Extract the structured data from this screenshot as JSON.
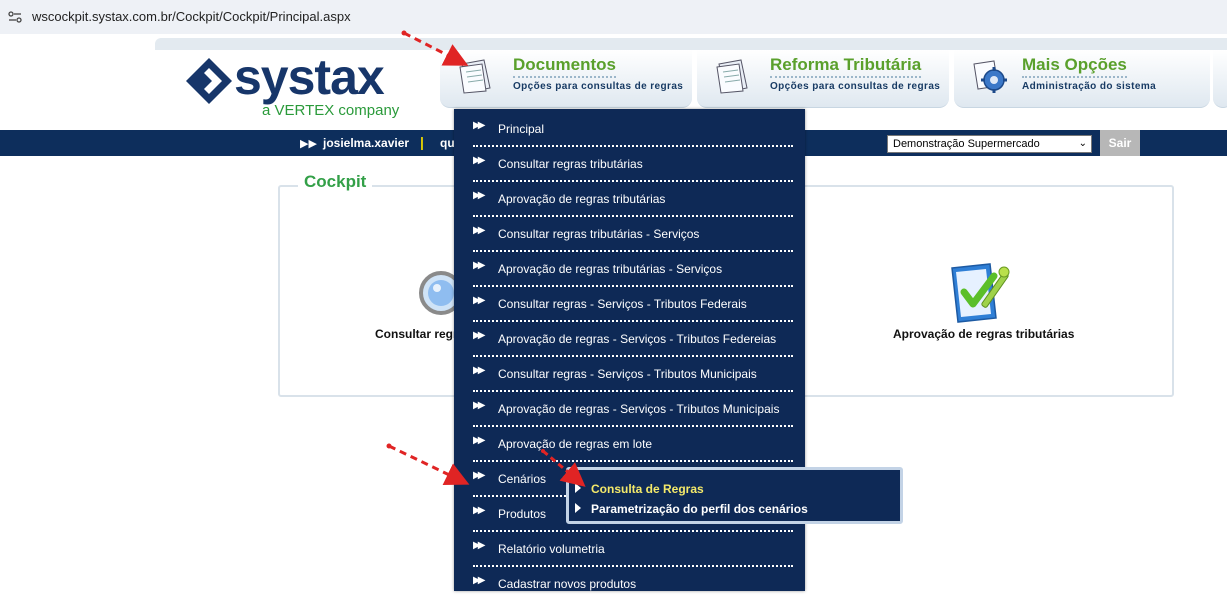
{
  "browser": {
    "url": "wscockpit.systax.com.br/Cockpit/Cockpit/Principal.aspx"
  },
  "logo": {
    "word": "systax",
    "sub": "a VERTEX company"
  },
  "top_tabs": [
    {
      "title": "Documentos",
      "subtitle": "Opções para consultas de regras",
      "icon": "documents-icon"
    },
    {
      "title": "Reforma Tributária",
      "subtitle": "Opções para consultas de regras",
      "icon": "documents-icon"
    },
    {
      "title": "Mais Opções",
      "subtitle": "Administração do sistema",
      "icon": "gear-icon"
    }
  ],
  "navbar": {
    "user": "josielma.xavier",
    "separator": "|",
    "truncated": "qu",
    "company_select": "Demonstração Supermercado",
    "logout_label": "Sair"
  },
  "panel": {
    "title": "Cockpit",
    "cards": [
      {
        "label": "Consultar regr",
        "icon": "magnifier-icon"
      },
      {
        "label": "Aprovação de regras tributárias",
        "icon": "approval-check-icon"
      }
    ]
  },
  "documents_menu": {
    "items": [
      "Principal",
      "Consultar regras tributárias",
      "Aprovação de regras tributárias",
      "Consultar regras tributárias - Serviços",
      "Aprovação de regras tributárias - Serviços",
      "Consultar regras - Serviços - Tributos Federais",
      "Aprovação de regras - Serviços - Tributos Federeias",
      "Consultar regras - Serviços - Tributos Municipais",
      "Aprovação de regras - Serviços - Tributos Municipais",
      "Aprovação de regras em lote",
      "Cenários",
      "Produtos",
      "Relatório volumetria",
      "Cadastrar novos produtos"
    ]
  },
  "cenarios_submenu": {
    "items": [
      {
        "label": "Consulta de Regras",
        "color": "#f4e96a",
        "highlighted": true
      },
      {
        "label": "Parametrização do perfil dos cenários",
        "color": "#ffffff",
        "highlighted": false
      }
    ]
  },
  "colors": {
    "navy": "#0d2e5c",
    "green": "#5aa02c",
    "annotation_red": "#e02424"
  }
}
